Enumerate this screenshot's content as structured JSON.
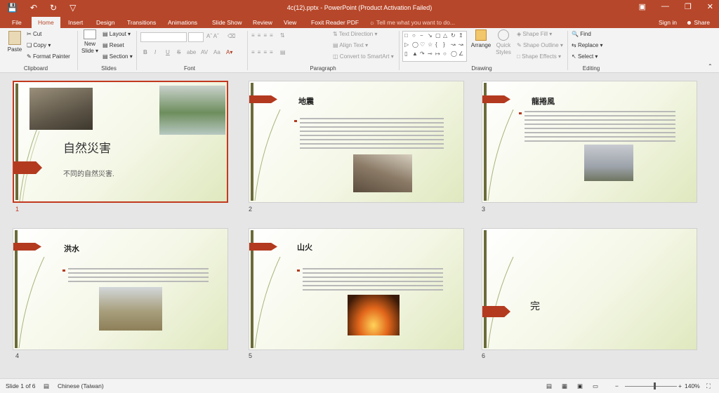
{
  "window": {
    "title": "4c(12).pptx - PowerPoint (Product Activation Failed)",
    "qat": [
      "save-icon",
      "undo-icon",
      "redo-icon",
      "customize-icon"
    ],
    "controls": [
      "ribbon-display-icon",
      "minimize-icon",
      "restore-icon",
      "close-icon"
    ]
  },
  "tabs": [
    "File",
    "Home",
    "Insert",
    "Design",
    "Transitions",
    "Animations",
    "Slide Show",
    "Review",
    "View",
    "Foxit Reader PDF"
  ],
  "active_tab": "Home",
  "tell_me": "Tell me what you want to do...",
  "sign_in": "Sign in",
  "share": "Share",
  "ribbon": {
    "clipboard": {
      "label": "Clipboard",
      "paste": "Paste",
      "cut": "Cut",
      "copy": "Copy",
      "format_painter": "Format Painter"
    },
    "slides": {
      "label": "Slides",
      "new_slide_1": "New",
      "new_slide_2": "Slide",
      "layout": "Layout",
      "reset": "Reset",
      "section": "Section"
    },
    "font": {
      "label": "Font",
      "bold": "B",
      "italic": "I",
      "underline": "U",
      "strike": "S",
      "shadow": "abe",
      "spacing": "AV",
      "case": "Aa"
    },
    "paragraph": {
      "label": "Paragraph",
      "text_direction": "Text Direction",
      "align_text": "Align Text",
      "smartart": "Convert to SmartArt"
    },
    "drawing": {
      "label": "Drawing",
      "arrange_1": "Arrange",
      "quick_styles_1": "Quick",
      "quick_styles_2": "Styles",
      "shape_fill": "Shape Fill",
      "shape_outline": "Shape Outline",
      "shape_effects": "Shape Effects"
    },
    "editing": {
      "label": "Editing",
      "find": "Find",
      "replace": "Replace",
      "select": "Select"
    }
  },
  "slides": [
    {
      "number": "1",
      "title": "自然災害",
      "subtitle": "不同的自然災害."
    },
    {
      "number": "2",
      "title": "地震"
    },
    {
      "number": "3",
      "title": "龍捲風"
    },
    {
      "number": "4",
      "title": "洪水"
    },
    {
      "number": "5",
      "title": "山火"
    },
    {
      "number": "6",
      "title": "完"
    }
  ],
  "status": {
    "slide_info": "Slide 1 of 6",
    "language": "Chinese (Taiwan)",
    "zoom": "140%"
  },
  "colors": {
    "accent": "#b7472a",
    "selected_border": "#c2391f",
    "slide_arrow": "#b33a1f"
  }
}
